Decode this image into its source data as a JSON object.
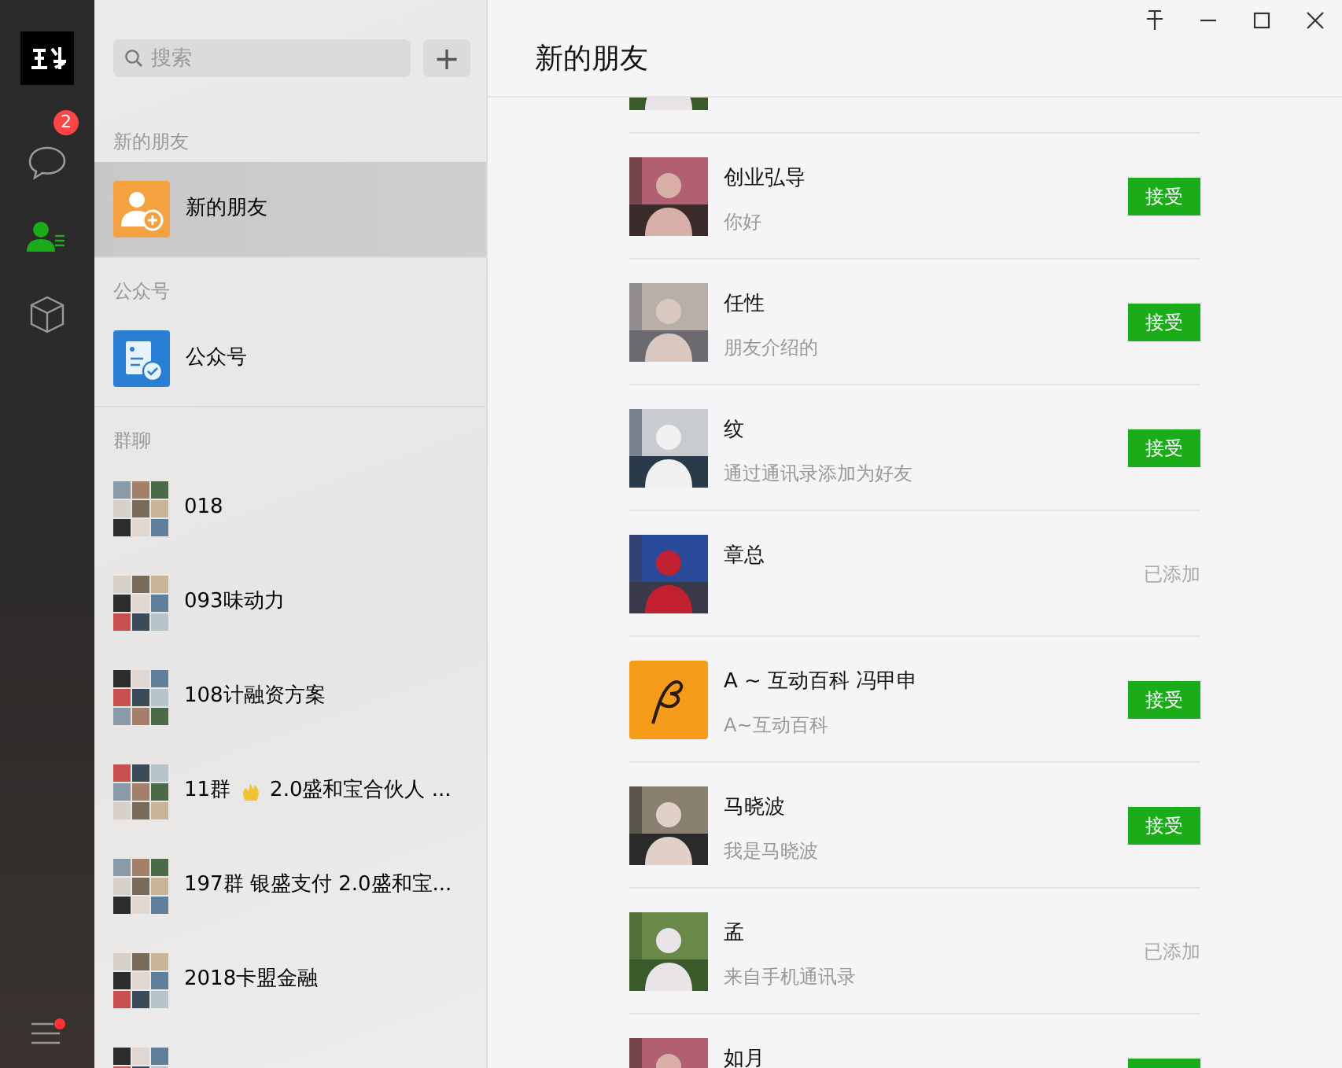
{
  "sidebar": {
    "badge": "2",
    "items": [
      {
        "kind": "chat",
        "selected": false
      },
      {
        "kind": "contacts",
        "selected": true
      },
      {
        "kind": "box",
        "selected": false
      }
    ],
    "menu_dot": true
  },
  "contacts": {
    "search": {
      "placeholder": "搜索"
    },
    "add_button": "+",
    "sections": [
      {
        "header": "新的朋友",
        "items": [
          {
            "kind": "new-friends",
            "name": "新的朋友",
            "selected": true
          }
        ]
      },
      {
        "header": "公众号",
        "items": [
          {
            "kind": "official",
            "name": "公众号",
            "selected": false
          }
        ]
      },
      {
        "header": "群聊",
        "items": [
          {
            "kind": "group",
            "name": "018",
            "selected": false
          },
          {
            "kind": "group",
            "name": "093味动力",
            "selected": false
          },
          {
            "kind": "group",
            "name": "108计融资方案",
            "selected": false
          },
          {
            "kind": "group",
            "name": "11群",
            "name_after_icon": "2.0盛和宝合伙人 ...",
            "selected": false
          },
          {
            "kind": "group",
            "name": "197群 银盛支付 2.0盛和宝...",
            "selected": false
          },
          {
            "kind": "group",
            "name": "2018卡盟金融",
            "selected": false
          },
          {
            "kind": "group",
            "selected": false
          }
        ]
      }
    ]
  },
  "main": {
    "title": "新的朋友",
    "requests": [
      {
        "kind": "partial"
      },
      {
        "name": "创业弘导",
        "message": "你好",
        "added": false,
        "action": "接受"
      },
      {
        "name": "任性",
        "message": "朋友介绍的",
        "added": false,
        "action": "接受"
      },
      {
        "name": "纹",
        "message": "通过通讯录添加为好友",
        "added": false,
        "action": "接受"
      },
      {
        "name": "章总",
        "added": true,
        "action": "已添加"
      },
      {
        "kind": "logo",
        "name": "A ~ 互动百科 冯甲申",
        "message": "A~互动百科",
        "added": false,
        "action": "接受"
      },
      {
        "name": "马晓波",
        "message": "我是马晓波",
        "added": false,
        "action": "接受"
      },
      {
        "name": "孟",
        "message": "来自手机通讯录",
        "added": true,
        "action": "已添加"
      },
      {
        "name": "如月",
        "added": false
      }
    ]
  }
}
